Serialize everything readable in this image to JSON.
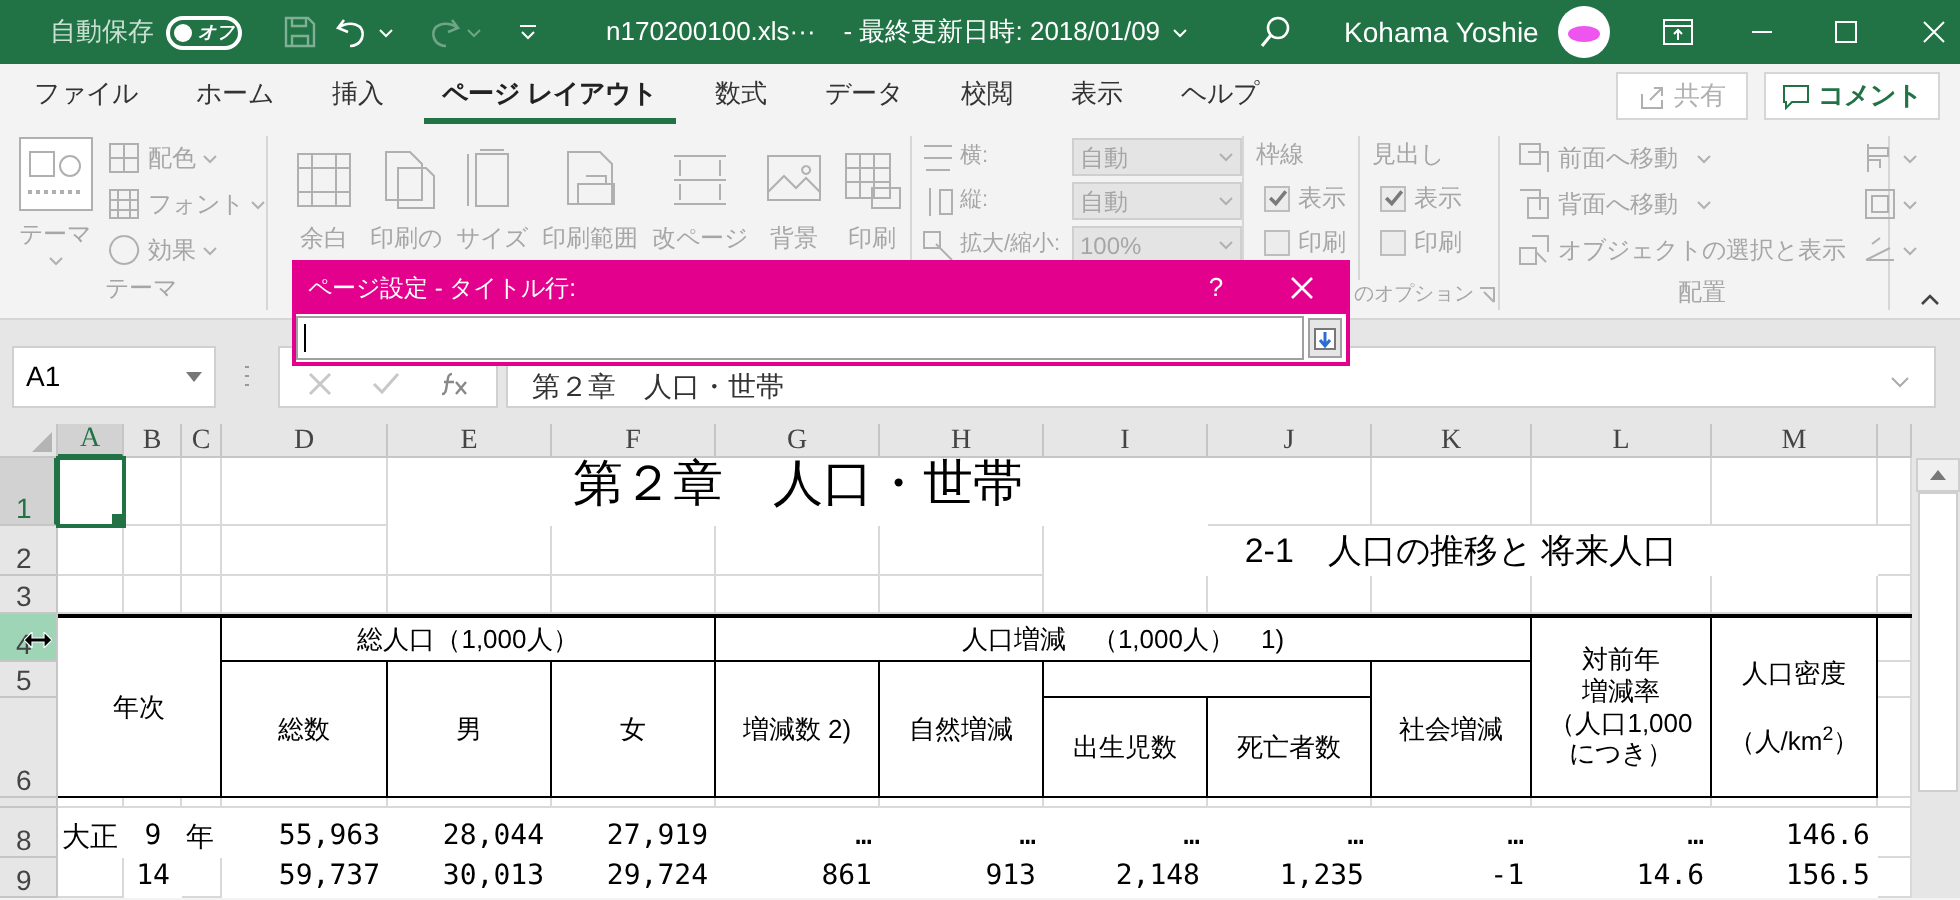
{
  "title_bar": {
    "autosave_label": "自動保存",
    "autosave_toggle": {
      "label": "オフ",
      "on": false
    },
    "filename": "n170200100.xls···",
    "modified": "- 最終更新日時: 2018/01/09",
    "user": "Kohama Yoshie"
  },
  "tabs": [
    {
      "label": "ファイル",
      "selected": false
    },
    {
      "label": "ホーム",
      "selected": false
    },
    {
      "label": "挿入",
      "selected": false
    },
    {
      "label": "ページ レイアウト",
      "selected": true
    },
    {
      "label": "数式",
      "selected": false
    },
    {
      "label": "データ",
      "selected": false
    },
    {
      "label": "校閲",
      "selected": false
    },
    {
      "label": "表示",
      "selected": false
    },
    {
      "label": "ヘルプ",
      "selected": false
    }
  ],
  "share_button": "共有",
  "comment_button": "コメント",
  "ribbon": {
    "disabled": true,
    "groups": [
      {
        "kind": "theme",
        "label": "テーマ",
        "big": "テーマ",
        "items": [
          "配色",
          "フォント",
          "効果"
        ]
      },
      {
        "kind": "page_setup",
        "buttons": [
          "余白",
          "印刷の",
          "サイズ",
          "印刷範囲",
          "改ページ",
          "背景",
          "印刷"
        ]
      },
      {
        "kind": "scale",
        "rows": [
          {
            "label": "横:",
            "value": "自動"
          },
          {
            "label": "縦:",
            "value": "自動"
          },
          {
            "label": "拡大/縮小:",
            "value": "100%"
          }
        ]
      },
      {
        "kind": "sheet_options",
        "label": "のオプション",
        "columns": [
          {
            "title": "枠線",
            "show": {
              "label": "表示",
              "checked": true
            },
            "print": {
              "label": "印刷",
              "checked": false
            }
          },
          {
            "title": "見出し",
            "show": {
              "label": "表示",
              "checked": true
            },
            "print": {
              "label": "印刷",
              "checked": false
            }
          }
        ]
      },
      {
        "kind": "arrange",
        "label": "配置",
        "items": [
          "前面へ移動",
          "背面へ移動",
          "オブジェクトの選択と表示"
        ]
      }
    ]
  },
  "formula_bar": {
    "name_box": "A1",
    "formula": "第２章　人口・世帯"
  },
  "dialog": {
    "title": "ページ設定 - タイトル行:",
    "help": "?"
  },
  "sheet": {
    "columns": [
      {
        "label": "A",
        "selected": true
      },
      {
        "label": "B",
        "selected": false
      },
      {
        "label": "C",
        "selected": false
      },
      {
        "label": "D",
        "selected": false
      },
      {
        "label": "E",
        "selected": false
      },
      {
        "label": "F",
        "selected": false
      },
      {
        "label": "G",
        "selected": false
      },
      {
        "label": "H",
        "selected": false
      },
      {
        "label": "I",
        "selected": false
      },
      {
        "label": "J",
        "selected": false
      },
      {
        "label": "K",
        "selected": false
      },
      {
        "label": "L",
        "selected": false
      },
      {
        "label": "M",
        "selected": false
      }
    ],
    "rows": [
      {
        "label": "1",
        "selected": true,
        "hovered": false,
        "cells": {
          "E": "第２章　人口・世帯"
        }
      },
      {
        "label": "2",
        "selected": false,
        "hovered": false,
        "cells": {
          "I": "2-1　人口の推移と 将来人口"
        }
      },
      {
        "label": "3",
        "selected": false,
        "hovered": false
      },
      {
        "label": "4",
        "selected": false,
        "hovered": true,
        "cells": {
          "A": "年次",
          "D": "総人口（1,000人）",
          "G": "人口増減　（1,000人）　1)",
          "L": [
            "対前年",
            "増減率",
            "（人口1,000",
            "につき）"
          ],
          "M": [
            "人口密度",
            "（人/km$^{2}$）"
          ]
        }
      },
      {
        "label": "5",
        "selected": false,
        "hovered": false,
        "cells": {
          "D": "総数",
          "E": "男",
          "F": "女",
          "G": "増減数 2)",
          "H": "自然増減",
          "K": "社会増減"
        }
      },
      {
        "label": "6",
        "selected": false,
        "hovered": false,
        "cells": {
          "I": "出生児数",
          "J": "死亡者数"
        }
      },
      {
        "selected": false,
        "hovered": false
      },
      {
        "label": "8",
        "selected": false,
        "hovered": false,
        "cells": {
          "A": "大正",
          "B": "9",
          "C": "年",
          "D": "55,963",
          "E": "28,044",
          "F": "27,919",
          "G": "…",
          "H": "…",
          "I": "…",
          "J": "…",
          "K": "…",
          "L": "…",
          "M": "146.6"
        }
      },
      {
        "label": "9",
        "selected": false,
        "hovered": false,
        "cells": {
          "B": "14",
          "D": "59,737",
          "E": "30,013",
          "F": "29,724",
          "G": "861",
          "H": "913",
          "I": "2,148",
          "J": "1,235",
          "K": "-1",
          "L": "14.6",
          "M": "156.5"
        }
      }
    ]
  }
}
